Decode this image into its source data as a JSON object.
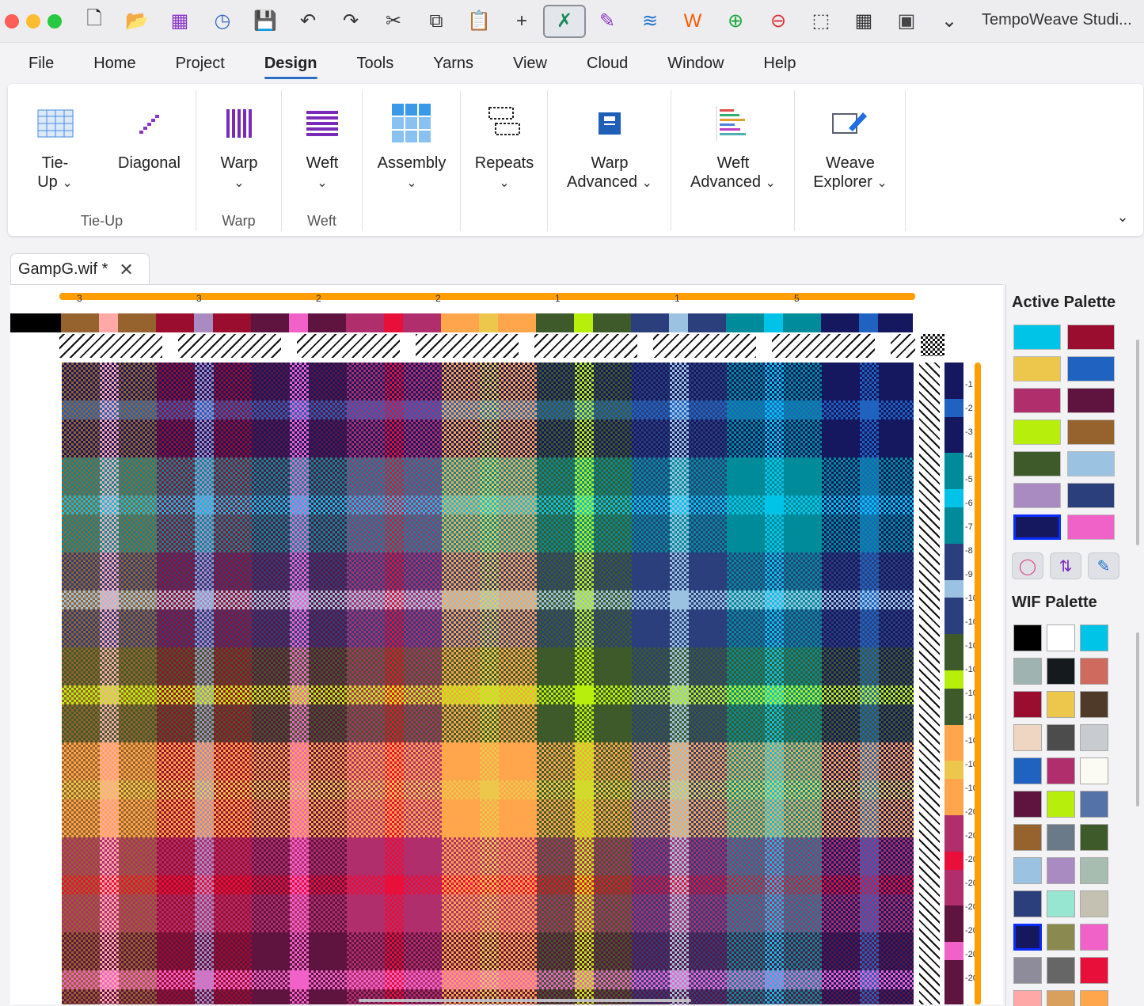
{
  "app": {
    "title": "TempoWeave Studi..."
  },
  "toolbar": {
    "icons": [
      "new-file-icon",
      "open-folder-icon",
      "grid-apps-icon",
      "history-clock-icon",
      "save-icon",
      "undo-icon",
      "redo-icon",
      "cut-scissors-icon",
      "copy-icon",
      "paste-clipboard-icon",
      "add-plus-icon",
      "drawdown-tool-icon",
      "pencil-icon",
      "sliders-icon",
      "zigzag-icon",
      "zoom-in-icon",
      "zoom-out-icon",
      "select-rect-icon",
      "layout-grid-icon",
      "crop-select-icon",
      "chevron-down-icon"
    ]
  },
  "menu": {
    "items": [
      "File",
      "Home",
      "Project",
      "Design",
      "Tools",
      "Yarns",
      "View",
      "Cloud",
      "Window",
      "Help"
    ],
    "active": "Design"
  },
  "ribbon": {
    "groups": [
      {
        "label": "Tie-Up",
        "buttons": [
          {
            "l1": "Tie-",
            "l2": "Up",
            "chev": true
          },
          {
            "l1": "Diagonal",
            "l2": "",
            "chev": false
          }
        ]
      },
      {
        "label": "Warp",
        "buttons": [
          {
            "l1": "Warp",
            "l2": "",
            "chev": true
          }
        ]
      },
      {
        "label": "Weft",
        "buttons": [
          {
            "l1": "Weft",
            "l2": "",
            "chev": true
          }
        ]
      },
      {
        "label": "",
        "buttons": [
          {
            "l1": "Assembly",
            "l2": "",
            "chev": true
          }
        ]
      },
      {
        "label": "",
        "buttons": [
          {
            "l1": "Repeats",
            "l2": "",
            "chev": true
          }
        ]
      },
      {
        "label": "",
        "buttons": [
          {
            "l1": "Warp",
            "l2": "Advanced",
            "chev": true
          }
        ]
      },
      {
        "label": "",
        "buttons": [
          {
            "l1": "Weft",
            "l2": "Advanced",
            "chev": true
          }
        ]
      },
      {
        "label": "",
        "buttons": [
          {
            "l1": "Weave",
            "l2": "Explorer",
            "chev": true
          }
        ]
      }
    ]
  },
  "document": {
    "tab_label": "GampG.wif *"
  },
  "ruler": {
    "ticks": [
      "3",
      "3",
      "2",
      "2",
      "1",
      "1",
      "5"
    ]
  },
  "warp_colors": [
    "#000000",
    "#96622d",
    "#ffa8a8",
    "#96622d",
    "#9a0d2e",
    "#a98bc2",
    "#9a0d2e",
    "#5f1440",
    "#f062c8",
    "#5f1440",
    "#b02e6b",
    "#e8103a",
    "#b02e6b",
    "#ffa54c",
    "#ecc74c",
    "#ffa54c",
    "#3f5a2a",
    "#b8ee0c",
    "#3f5a2a",
    "#2b3f7c",
    "#9bc3e1",
    "#2b3f7c",
    "#008b9a",
    "#00c3e8",
    "#008b9a",
    "#15175f",
    "#1f62c0",
    "#15175f"
  ],
  "weft_colors": [
    "#15175f",
    "#1f62c0",
    "#15175f",
    "#008b9a",
    "#00c3e8",
    "#008b9a",
    "#2b3f7c",
    "#9bc3e1",
    "#2b3f7c",
    "#3f5a2a",
    "#b8ee0c",
    "#3f5a2a",
    "#ffa54c",
    "#ecc74c",
    "#ffa54c",
    "#b02e6b",
    "#e8103a",
    "#b02e6b",
    "#5f1440",
    "#f062c8",
    "#5f1440"
  ],
  "weft_numbers": [
    "-1",
    "-2",
    "-3",
    "-4",
    "-5",
    "-6",
    "-7",
    "-8",
    "-9",
    "-10",
    "-10",
    "-10",
    "-10",
    "-10",
    "-10",
    "-10",
    "-10",
    "-10",
    "-20",
    "-20",
    "-20",
    "-20",
    "-20",
    "-20",
    "-20",
    "-20"
  ],
  "active_palette": {
    "title": "Active Palette",
    "colors": [
      "#00c3e8",
      "#9a0d2e",
      "#ecc74c",
      "#1f62c0",
      "#b02e6b",
      "#5f1440",
      "#b8ee0c",
      "#96622d",
      "#3f5a2a",
      "#9bc3e1",
      "#a98bc2",
      "#2b3f7c",
      "#15175f",
      "#f062c8"
    ],
    "selected_index": 12,
    "tools": [
      "color-wheel-icon",
      "swap-colors-icon",
      "edit-color-icon"
    ]
  },
  "wif_palette": {
    "title": "WIF Palette",
    "colors": [
      "#000000",
      "#ffffff",
      "#00c3e8",
      "#9fb3b0",
      "#141a1d",
      "#cf6a5e",
      "#9a0d2e",
      "#ecc74c",
      "#4f3a2a",
      "#efd6c2",
      "#4c4c4c",
      "#c8ccd0",
      "#1f62c0",
      "#b02e6b",
      "#fbfbf3",
      "#5f1440",
      "#b8ee0c",
      "#5572a8",
      "#96622d",
      "#6a7a88",
      "#3f5a2a",
      "#9bc3e1",
      "#a98bc2",
      "#a6bdb0",
      "#2b3f7c",
      "#96e6d2",
      "#c4c0b2",
      "#15175f",
      "#8a8a50",
      "#f062c8",
      "#8e8c9a",
      "#666666",
      "#e8103a",
      "#ffa8a8",
      "#d8a05c",
      "#ffa54c"
    ],
    "selected_index": 27
  }
}
